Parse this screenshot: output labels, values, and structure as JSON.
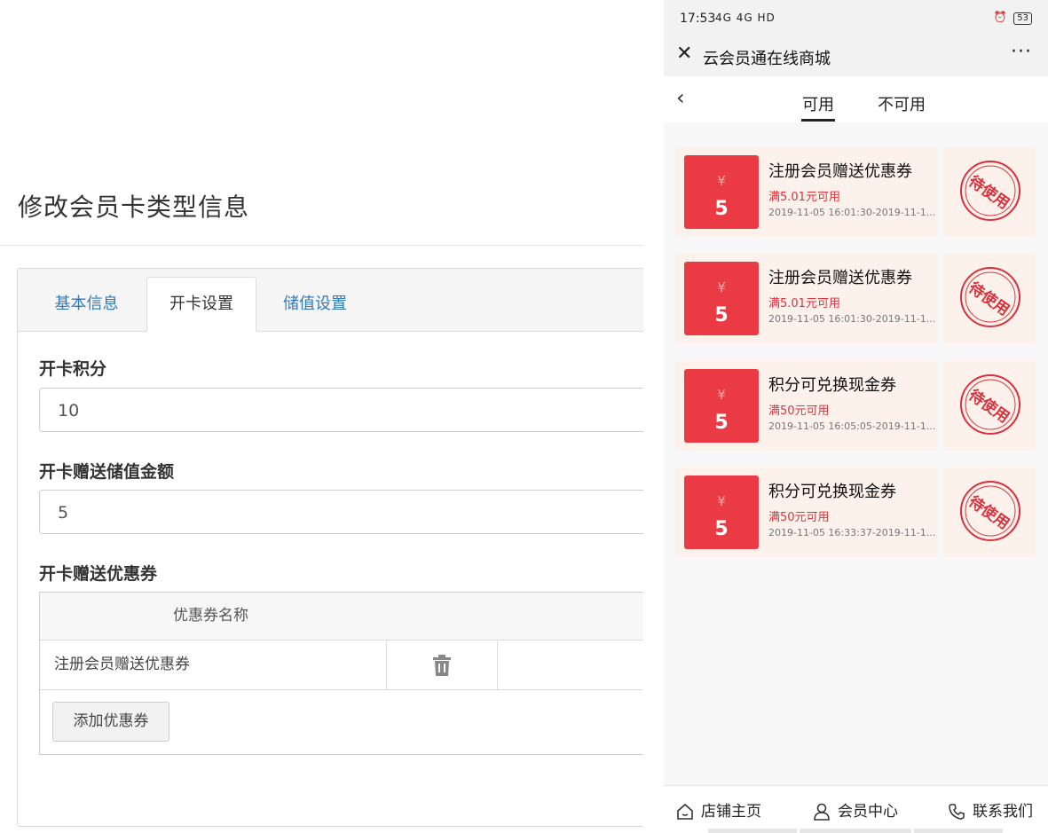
{
  "admin": {
    "page_title": "修改会员卡类型信息",
    "tabs": [
      {
        "label": "基本信息"
      },
      {
        "label": "开卡设置",
        "active": true
      },
      {
        "label": "储值设置"
      }
    ],
    "points_label": "开卡积分",
    "points_value": "10",
    "stored_value_label": "开卡赠送储值金额",
    "stored_value": "5",
    "coupon_label": "开卡赠送优惠券",
    "coupon_table": {
      "header": "优惠券名称",
      "rows": [
        {
          "name": "注册会员赠送优惠券",
          "action_icon": "trash-icon"
        }
      ]
    },
    "add_coupon_button": "添加优惠券"
  },
  "phone": {
    "status": {
      "time": "17:53",
      "signal": "4G 4G HD",
      "battery": "53"
    },
    "app_title": "云会员通在线商城",
    "more": "···",
    "tabs": [
      {
        "label": "可用",
        "active": true
      },
      {
        "label": "不可用"
      }
    ],
    "coupons": [
      {
        "currency": "¥",
        "amount": "5",
        "title": "注册会员赠送优惠券",
        "condition": "满5.01元可用",
        "validity": "2019-11-05 16:01:30-2019-11-1...",
        "stamp": "待使用"
      },
      {
        "currency": "¥",
        "amount": "5",
        "title": "注册会员赠送优惠券",
        "condition": "满5.01元可用",
        "validity": "2019-11-05 16:01:30-2019-11-1...",
        "stamp": "待使用"
      },
      {
        "currency": "¥",
        "amount": "5",
        "title": "积分可兑换现金券",
        "condition": "满50元可用",
        "validity": "2019-11-05 16:05:05-2019-11-1...",
        "stamp": "待使用"
      },
      {
        "currency": "¥",
        "amount": "5",
        "title": "积分可兑换现金券",
        "condition": "满50元可用",
        "validity": "2019-11-05 16:33:37-2019-11-1...",
        "stamp": "待使用"
      }
    ],
    "bottom_nav": [
      {
        "label": "店铺主页",
        "icon": "home-icon"
      },
      {
        "label": "会员中心",
        "icon": "user-icon"
      },
      {
        "label": "联系我们",
        "icon": "phone-icon"
      }
    ],
    "colors": {
      "accent": "#ea3b44",
      "coupon_bg": "#fdf1ec",
      "condition": "#e0323c"
    }
  }
}
